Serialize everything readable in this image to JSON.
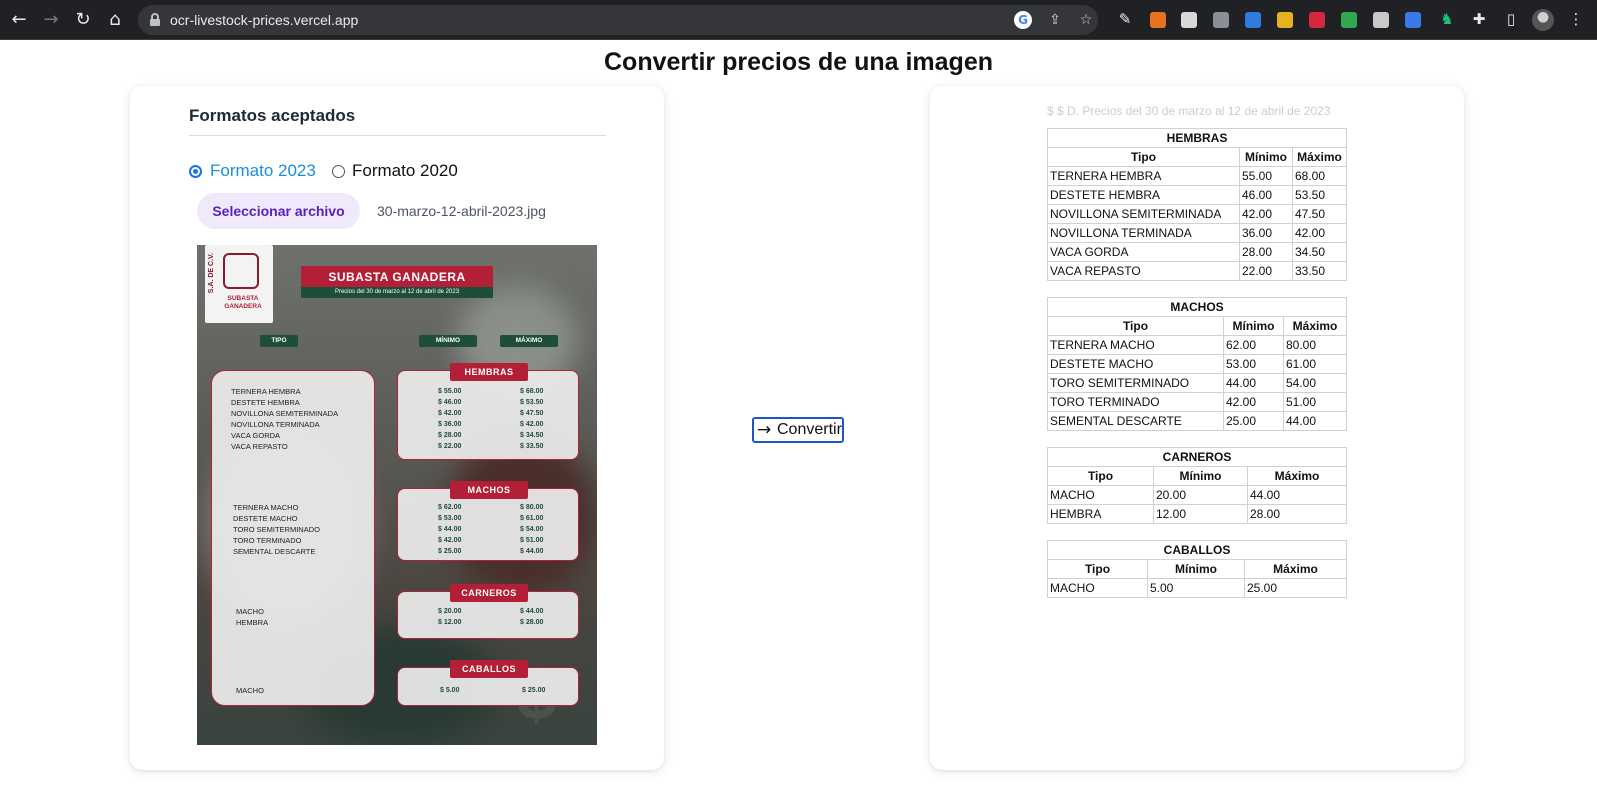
{
  "browser": {
    "url": "ocr-livestock-prices.vercel.app"
  },
  "page": {
    "title": "Convertir precios de una imagen"
  },
  "upload": {
    "heading": "Formatos aceptados",
    "formats": [
      {
        "label": "Formato 2023",
        "selected": true
      },
      {
        "label": "Formato 2020",
        "selected": false
      }
    ],
    "file_button": "Seleccionar archivo",
    "file_name": "30-marzo-12-abril-2023.jpg"
  },
  "poster": {
    "logo_side": "S.A. DE C.V.",
    "logo_text": "SUBASTA GANADERA",
    "banner": "SUBASTA GANADERA",
    "banner_sub": "Precios del 30 de marzo  al 12 de abril de 2023",
    "col_tipo": "TIPO",
    "col_min": "MÍNIMO",
    "col_max": "MÁXIMO",
    "sections": [
      {
        "tag": "HEMBRAS",
        "names": [
          "TERNERA HEMBRA",
          "DESTETE HEMBRA",
          "NOVILLONA SEMITERMINADA",
          "NOVILLONA TERMINADA",
          "VACA GORDA",
          "VACA REPASTO"
        ],
        "mins": [
          "$ 55.00",
          "$ 46.00",
          "$ 42.00",
          "$ 36.00",
          "$ 28.00",
          "$ 22.00"
        ],
        "maxs": [
          "$ 68.00",
          "$ 53.50",
          "$ 47.50",
          "$ 42.00",
          "$ 34.50",
          "$ 33.50"
        ]
      },
      {
        "tag": "MACHOS",
        "names": [
          "TERNERA MACHO",
          "DESTETE MACHO",
          "TORO SEMITERMINADO",
          "TORO TERMINADO",
          "SEMENTAL DESCARTE"
        ],
        "mins": [
          "$ 62.00",
          "$ 53.00",
          "$ 44.00",
          "$ 42.00",
          "$ 25.00"
        ],
        "maxs": [
          "$ 80.00",
          "$ 61.00",
          "$ 54.00",
          "$ 51.00",
          "$ 44.00"
        ]
      },
      {
        "tag": "CARNEROS",
        "names": [
          "MACHO",
          "HEMBRA"
        ],
        "mins": [
          "$ 20.00",
          "$ 12.00"
        ],
        "maxs": [
          "$ 44.00",
          "$ 28.00"
        ]
      },
      {
        "tag": "CABALLOS",
        "names": [
          "MACHO"
        ],
        "mins": [
          "$ 5.00"
        ],
        "maxs": [
          "$ 25.00"
        ]
      }
    ]
  },
  "convert_button": "Convertir",
  "results": {
    "subtitle": "$ $ D. Precios del 30 de marzo al 12 de abril de 2023",
    "headers": {
      "tipo": "Tipo",
      "min": "Mínimo",
      "max": "Máximo"
    },
    "tables": [
      {
        "title": "HEMBRAS",
        "rows": [
          [
            "TERNERA HEMBRA",
            "55.00",
            "68.00"
          ],
          [
            "DESTETE HEMBRA",
            "46.00",
            "53.50"
          ],
          [
            "NOVILLONA SEMITERMINADA",
            "42.00",
            "47.50"
          ],
          [
            "NOVILLONA TERMINADA",
            "36.00",
            "42.00"
          ],
          [
            "VACA GORDA",
            "28.00",
            "34.50"
          ],
          [
            "VACA REPASTO",
            "22.00",
            "33.50"
          ]
        ]
      },
      {
        "title": "MACHOS",
        "rows": [
          [
            "TERNERA MACHO",
            "62.00",
            "80.00"
          ],
          [
            "DESTETE MACHO",
            "53.00",
            "61.00"
          ],
          [
            "TORO SEMITERMINADO",
            "44.00",
            "54.00"
          ],
          [
            "TORO TERMINADO",
            "42.00",
            "51.00"
          ],
          [
            "SEMENTAL DESCARTE",
            "25.00",
            "44.00"
          ]
        ]
      },
      {
        "title": "CARNEROS",
        "rows": [
          [
            "MACHO",
            "20.00",
            "44.00"
          ],
          [
            "HEMBRA",
            "12.00",
            "28.00"
          ]
        ]
      },
      {
        "title": "CABALLOS",
        "rows": [
          [
            "MACHO",
            "5.00",
            "25.00"
          ]
        ]
      }
    ]
  }
}
